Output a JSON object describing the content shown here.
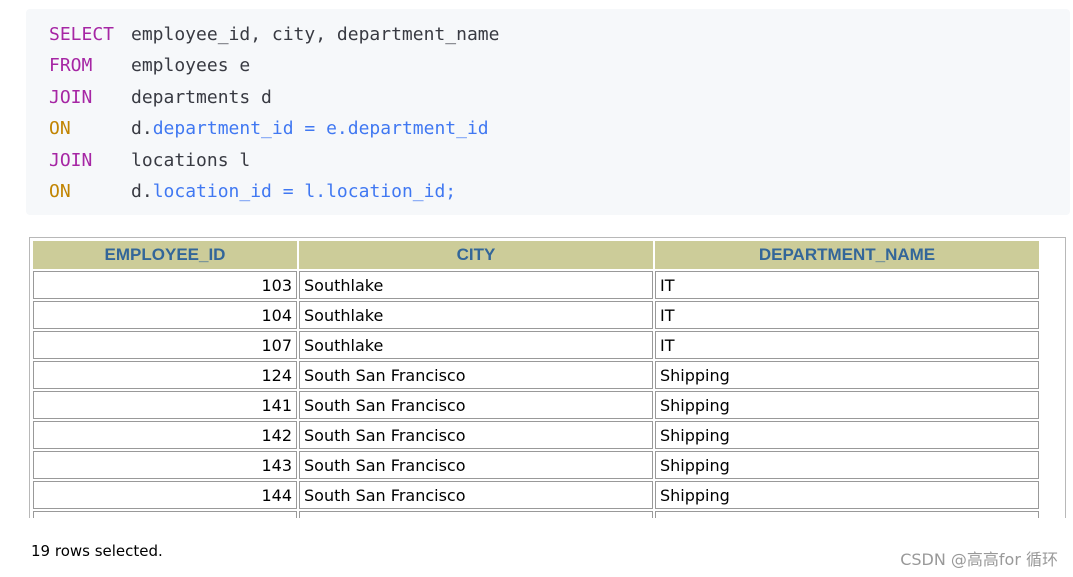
{
  "sql": {
    "lines": [
      {
        "keyword": "SELECT",
        "text": "employee_id, city, department_name",
        "ref": "",
        "tail": ""
      },
      {
        "keyword": "FROM",
        "text": "employees e",
        "ref": "",
        "tail": ""
      },
      {
        "keyword": "JOIN",
        "text": "departments d",
        "ref": "",
        "tail": ""
      },
      {
        "keyword": "ON",
        "text": "d.",
        "ref": "department_id",
        "tail": " = e.department_id"
      },
      {
        "keyword": "JOIN",
        "text": "locations l",
        "ref": "",
        "tail": ""
      },
      {
        "keyword": "ON",
        "text": "d.",
        "ref": "location_id",
        "tail": " = l.location_id;"
      }
    ]
  },
  "table": {
    "headers": [
      "EMPLOYEE_ID",
      "CITY",
      "DEPARTMENT_NAME"
    ],
    "rows": [
      [
        "103",
        "Southlake",
        "IT"
      ],
      [
        "104",
        "Southlake",
        "IT"
      ],
      [
        "107",
        "Southlake",
        "IT"
      ],
      [
        "124",
        "South San Francisco",
        "Shipping"
      ],
      [
        "141",
        "South San Francisco",
        "Shipping"
      ],
      [
        "142",
        "South San Francisco",
        "Shipping"
      ],
      [
        "143",
        "South San Francisco",
        "Shipping"
      ],
      [
        "144",
        "South San Francisco",
        "Shipping"
      ],
      [
        "",
        "",
        ""
      ]
    ]
  },
  "status": "19 rows selected.",
  "watermark": "CSDN @高高for 循环",
  "colors": {
    "header_bg": "#cccc99",
    "header_text": "#336699",
    "keyword": "#a626a4",
    "code_bg": "#f6f8fa"
  }
}
